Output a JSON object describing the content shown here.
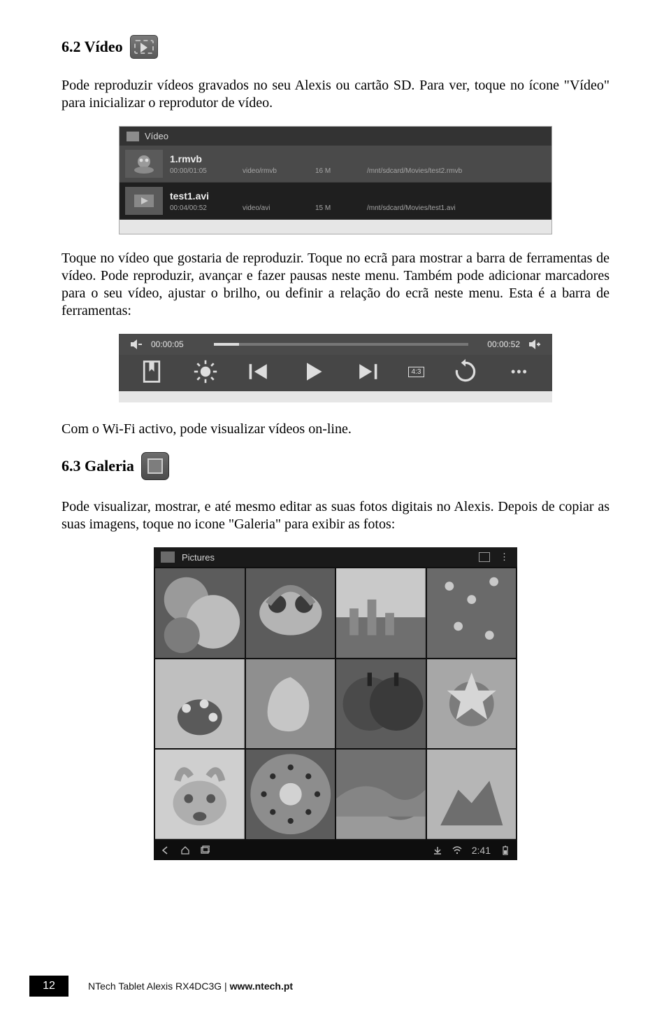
{
  "section62": {
    "title": "6.2 Vídeo"
  },
  "p1": "Pode reproduzir vídeos gravados no seu Alexis ou cartão SD. Para ver, toque no ícone \"Vídeo\" para inicializar o reprodutor de vídeo.",
  "videoList": {
    "header": "Vídeo",
    "rows": [
      {
        "name": "1.rmvb",
        "dur": "00:00/01:05",
        "mime": "video/rmvb",
        "size": "16 M",
        "path": "/mnt/sdcard/Movies/test2.rmvb"
      },
      {
        "name": "test1.avi",
        "dur": "00:04/00:52",
        "mime": "video/avi",
        "size": "15 M",
        "path": "/mnt/sdcard/Movies/test1.avi"
      }
    ]
  },
  "p2": "Toque no vídeo que gostaria de reproduzir. Toque no ecrã para mostrar a barra de ferramentas de vídeo. Pode reproduzir, avançar e fazer pausas neste menu. Também pode adicionar marcadores para o seu vídeo, ajustar o brilho, ou definir a relação do ecrã neste menu. Esta é a barra de ferramentas:",
  "toolbar": {
    "timeL": "00:00:05",
    "timeR": "00:00:52",
    "ratio": "4:3",
    "more": "•••"
  },
  "p3": "Com o Wi-Fi activo, pode visualizar vídeos on-line.",
  "section63": {
    "title": "6.3 Galeria"
  },
  "p4": "Pode visualizar, mostrar, e até mesmo editar as suas fotos digitais no Alexis. Depois de copiar as suas imagens, toque no icone \"Galeria\" para exibir as fotos:",
  "gallery": {
    "title": "Pictures",
    "navTime": "2:41",
    "dots": "⋮"
  },
  "footer": {
    "page": "12",
    "product": "NTech Tablet Alexis RX4DC3G | ",
    "url": "www.ntech.pt"
  }
}
